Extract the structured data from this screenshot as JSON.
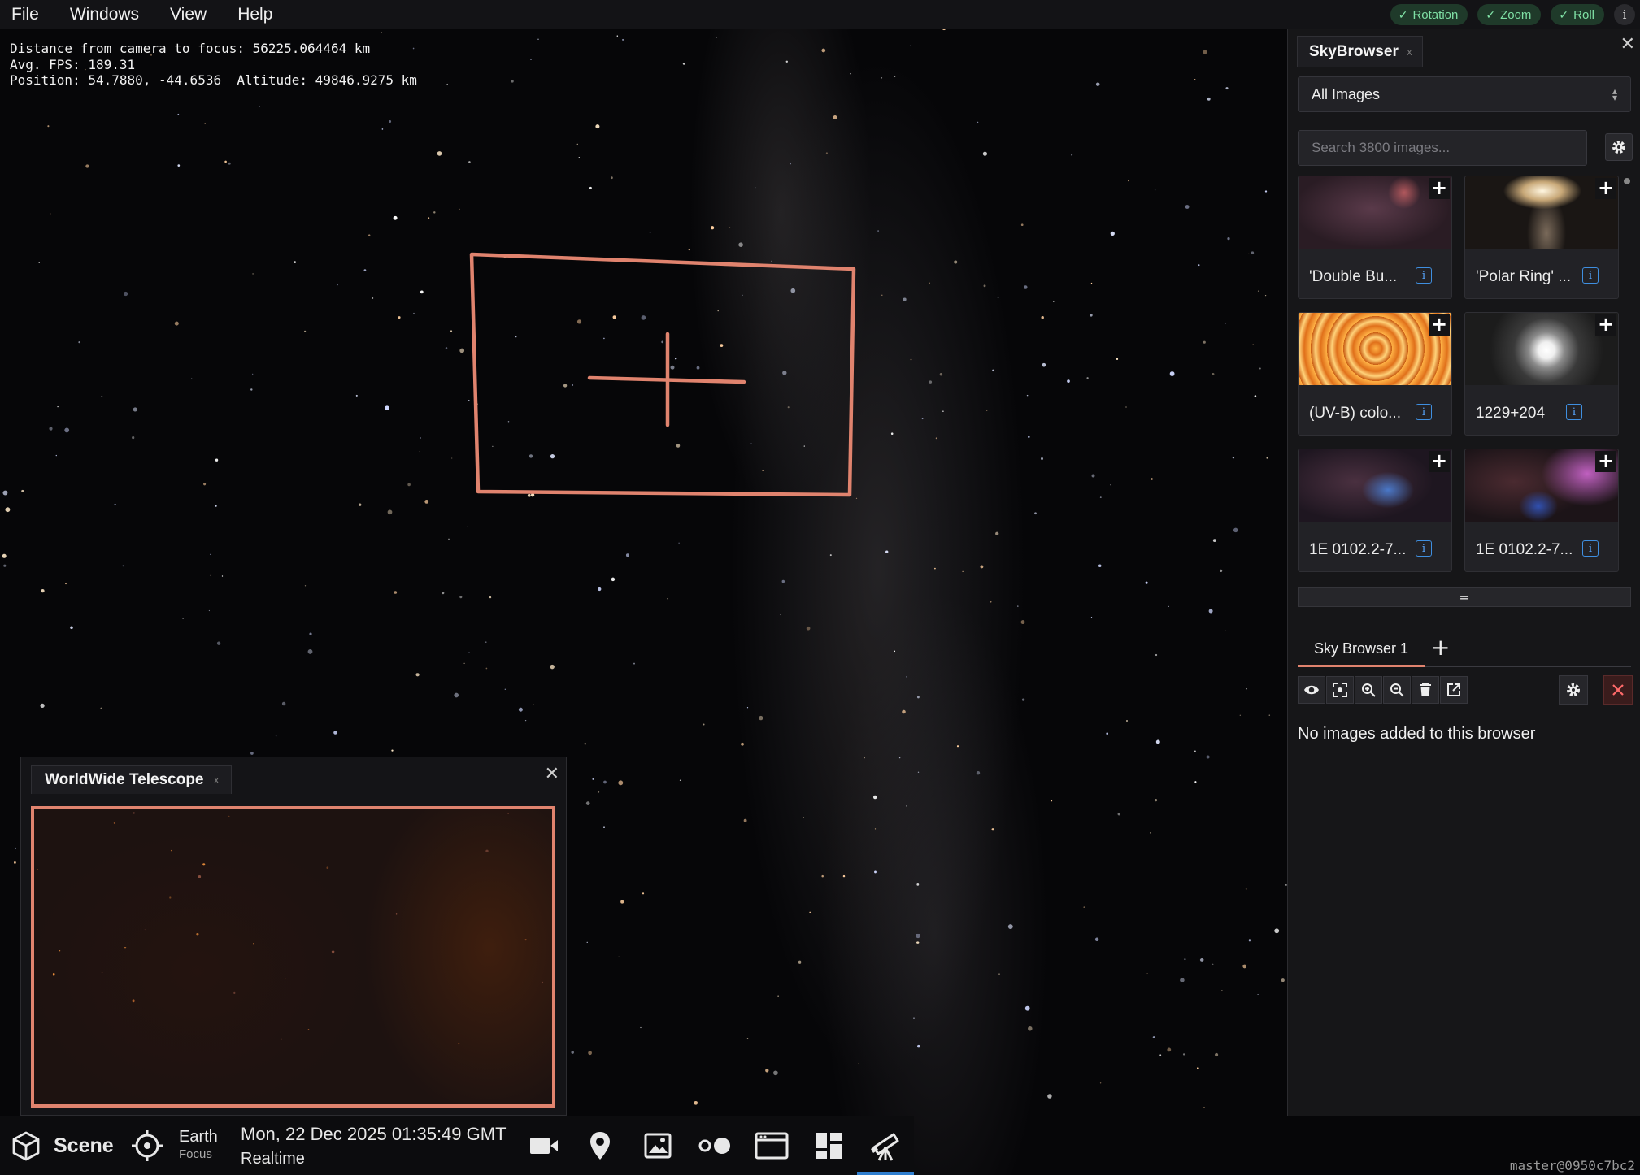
{
  "menu": {
    "items": [
      {
        "label": "File"
      },
      {
        "label": "Windows"
      },
      {
        "label": "View"
      },
      {
        "label": "Help"
      }
    ],
    "toggles": [
      {
        "label": "Rotation",
        "checked": true
      },
      {
        "label": "Zoom",
        "checked": true
      },
      {
        "label": "Roll",
        "checked": true
      }
    ],
    "info_label": "i",
    "toggle_color": "#7fe0a5"
  },
  "stats": {
    "distance": "Distance from camera to focus: 56225.064464 km",
    "fps": "Avg. FPS: 189.31",
    "position": "Position: 54.7880, -44.6536  Altitude: 49846.9275 km"
  },
  "target": {
    "color": "#e0836e"
  },
  "wwt_panel": {
    "title": "WorldWide Telescope",
    "tab_close": "x",
    "close": "✕"
  },
  "bottom_bar": {
    "scene_label": "Scene",
    "focus_name": "Earth",
    "focus_label": "Focus",
    "datetime": "Mon, 22 Dec 2025 01:35:49 GMT",
    "time_mode": "Realtime",
    "icons": [
      "camera-icon",
      "location-pin-icon",
      "image-icon",
      "toggle-dots-icon",
      "window-icon",
      "dashboard-icon",
      "telescope-icon"
    ],
    "active_color": "#2f7fd0"
  },
  "skybrowser": {
    "title": "SkyBrowser",
    "tab_close": "x",
    "close": "✕",
    "filter": {
      "selected": "All Images",
      "arrow": "⌃⌄"
    },
    "search": {
      "placeholder": "Search 3800 images..."
    },
    "cards": [
      {
        "name": "'Double Bu...",
        "add": "+",
        "info": "i"
      },
      {
        "name": "'Polar Ring' ...",
        "add": "+",
        "info": "i"
      },
      {
        "name": "(UV-B) colo...",
        "add": "+",
        "info": "i"
      },
      {
        "name": "1229+204",
        "add": "+",
        "info": "i"
      },
      {
        "name": "1E 0102.2-7...",
        "add": "+",
        "info": "i"
      },
      {
        "name": "1E 0102.2-7...",
        "add": "+",
        "info": "i"
      }
    ],
    "divider": "═",
    "browser_tabs": [
      {
        "label": "Sky Browser 1"
      }
    ],
    "add_browser": "+",
    "tools": [
      "eye-icon",
      "focus-icon",
      "zoom-in-icon",
      "zoom-out-icon",
      "trash-icon",
      "external-link-icon"
    ],
    "empty_message": "No images added to this browser",
    "accent": "#e0836e"
  },
  "version": "master@0950c7bc2"
}
